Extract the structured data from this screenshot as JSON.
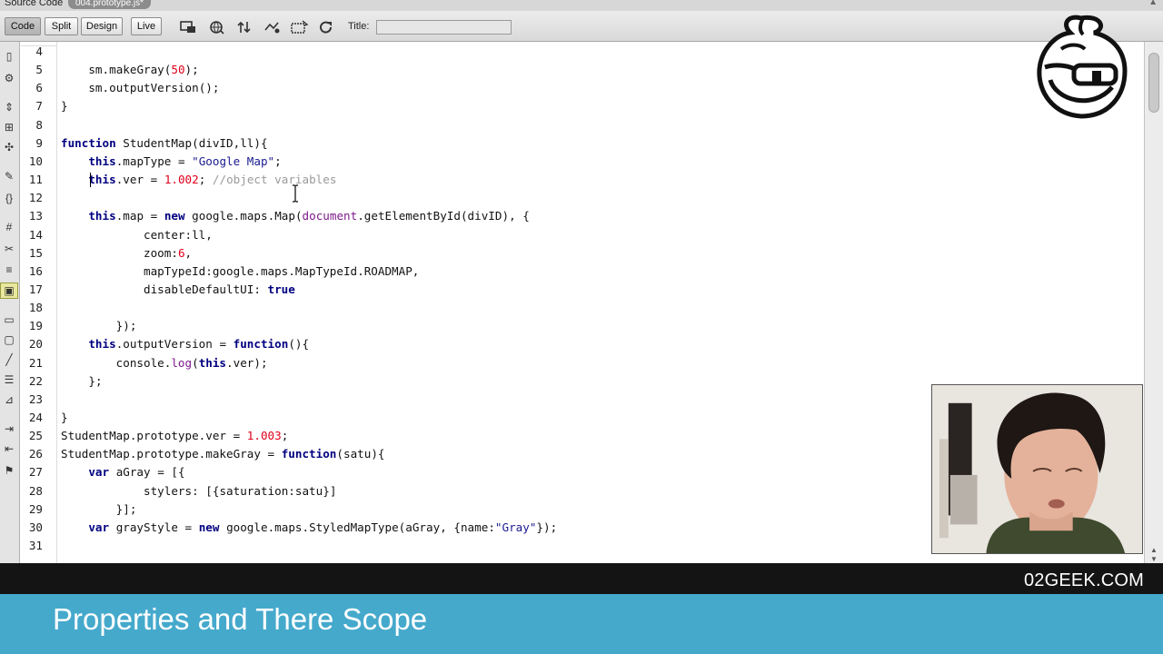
{
  "document_bar": {
    "label": "Source Code",
    "file_tab": "004.prototype.js*"
  },
  "toolbar": {
    "view_buttons": [
      "Code",
      "Split",
      "Design",
      "Live"
    ],
    "active_view": "Code",
    "icons": [
      "multiscreen-icon",
      "globe-preview-icon",
      "file-transfer-icon",
      "debug-icon",
      "visual-aids-icon",
      "refresh-icon"
    ],
    "title_label": "Title:",
    "title_value": ""
  },
  "sidebar": {
    "icons": [
      "document-icon",
      "gear-icon",
      "expand-icon",
      "collapse-icon",
      "select-icon",
      "wrench-icon",
      "braces-icon",
      "highlight-icon",
      "apply-comment-icon",
      "remove-comment-icon",
      "wrap-tag-icon",
      "snippet-icon",
      "indent-icon",
      "outdent-icon",
      "format-icon",
      "syntax-icon"
    ]
  },
  "editor": {
    "lines": [
      {
        "n": "4",
        "code": ""
      },
      {
        "n": "5",
        "code": "    sm.makeGray(50);"
      },
      {
        "n": "6",
        "code": "    sm.outputVersion();"
      },
      {
        "n": "7",
        "code": "}"
      },
      {
        "n": "8",
        "code": ""
      },
      {
        "n": "9",
        "code": "function StudentMap(divID,ll){"
      },
      {
        "n": "10",
        "code": "    this.mapType = \"Google Map\";"
      },
      {
        "n": "11",
        "code": "    this.ver = 1.002; //object variables"
      },
      {
        "n": "12",
        "code": ""
      },
      {
        "n": "13",
        "code": "    this.map = new google.maps.Map(document.getElementById(divID), {"
      },
      {
        "n": "14",
        "code": "            center:ll,"
      },
      {
        "n": "15",
        "code": "            zoom:6,"
      },
      {
        "n": "16",
        "code": "            mapTypeId:google.maps.MapTypeId.ROADMAP,"
      },
      {
        "n": "17",
        "code": "            disableDefaultUI: true"
      },
      {
        "n": "18",
        "code": ""
      },
      {
        "n": "19",
        "code": "        });"
      },
      {
        "n": "20",
        "code": "    this.outputVersion = function(){"
      },
      {
        "n": "21",
        "code": "        console.log(this.ver);"
      },
      {
        "n": "22",
        "code": "    };"
      },
      {
        "n": "23",
        "code": ""
      },
      {
        "n": "24",
        "code": "}"
      },
      {
        "n": "25",
        "code": "StudentMap.prototype.ver = 1.003;"
      },
      {
        "n": "26",
        "code": "StudentMap.prototype.makeGray = function(satu){"
      },
      {
        "n": "27",
        "code": "    var aGray = [{"
      },
      {
        "n": "28",
        "code": "            stylers: [{saturation:satu}]"
      },
      {
        "n": "29",
        "code": "        }];"
      },
      {
        "n": "30",
        "code": "    var grayStyle = new google.maps.StyledMapType(aGray, {name:\"Gray\"});"
      },
      {
        "n": "31",
        "code": ""
      }
    ]
  },
  "brand": "02GEEK.COM",
  "lesson_title": "Properties and There Scope",
  "colors": {
    "keyword": "#000080",
    "number": "#e0001b",
    "builtin": "#7d1a8b",
    "comment": "#9a9a9a",
    "title_bar": "#45a9cc",
    "brand_bar": "#141414"
  }
}
